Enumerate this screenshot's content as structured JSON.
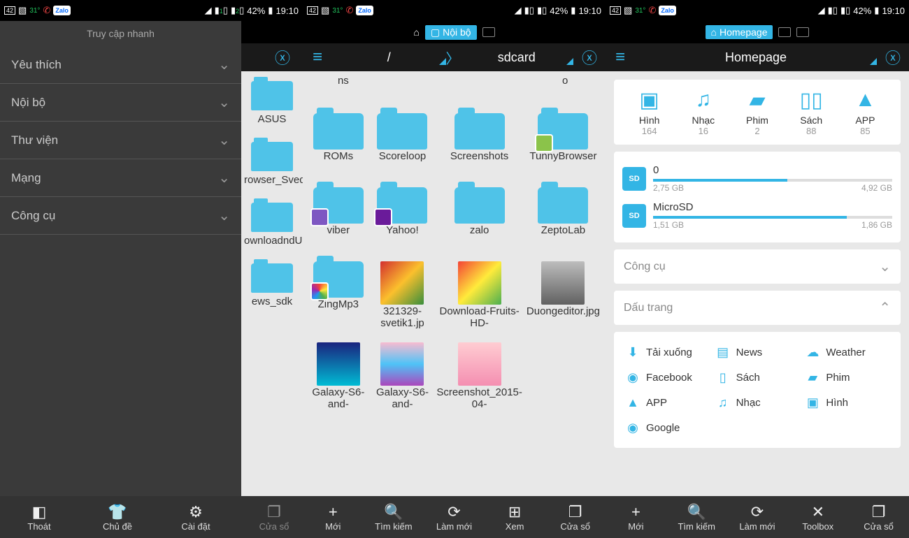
{
  "status": {
    "temp": "31°",
    "battery": "42%",
    "time": "19:10",
    "notif": "42"
  },
  "panel1": {
    "sidebar_title": "Truy cập nhanh",
    "items": [
      "Yêu thích",
      "Nội bộ",
      "Thư viện",
      "Mạng",
      "Công cụ"
    ],
    "bg_folders": [
      "ASUS",
      "rowser_SvedfiIes",
      "ownloadndUploa",
      "ews_sdk"
    ],
    "bottom": [
      "Thoát",
      "Chủ đề",
      "Cài đặt",
      "Cửa sổ"
    ]
  },
  "panel2": {
    "tab": "Nội bộ",
    "path": {
      "root": "/",
      "current": "sdcard"
    },
    "top_labels": [
      "ns",
      "o"
    ],
    "folders": [
      {
        "name": "ROMs",
        "type": "folder"
      },
      {
        "name": "Scoreloop",
        "type": "folder"
      },
      {
        "name": "Screenshots",
        "type": "folder"
      },
      {
        "name": "TunnyBrowser",
        "type": "folder",
        "badge": "#8bc34a"
      },
      {
        "name": "viber",
        "type": "folder",
        "badge": "#7e57c2"
      },
      {
        "name": "Yahoo!",
        "type": "folder",
        "badge": "#6a1b9a"
      },
      {
        "name": "zalo",
        "type": "folder"
      },
      {
        "name": "ZeptoLab",
        "type": "folder"
      },
      {
        "name": "ZingMp3",
        "type": "folder",
        "badge": "grad"
      },
      {
        "name": "321329-svetik1.jp",
        "type": "img",
        "bg": "linear-gradient(135deg,#d32f2f,#fbc02d,#388e3c)"
      },
      {
        "name": "Download-Fruits-HD-",
        "type": "img",
        "bg": "linear-gradient(135deg,#f44336,#ffeb3b,#4caf50)"
      },
      {
        "name": "Duongeditor.jpg",
        "type": "img",
        "bg": "linear-gradient(#bdbdbd,#616161)"
      },
      {
        "name": "Galaxy-S6-and-",
        "type": "img",
        "bg": "linear-gradient(180deg,#1a237e,#00bcd4)"
      },
      {
        "name": "Galaxy-S6-and-",
        "type": "img",
        "bg": "linear-gradient(180deg,#f8bbd0,#4fc3f7,#ab47bc)"
      },
      {
        "name": "Screenshot_2015-04-",
        "type": "img",
        "bg": "linear-gradient(#ffcdd2,#f48fb1)"
      }
    ],
    "bottom": [
      "Mới",
      "Tìm kiếm",
      "Làm mới",
      "Xem",
      "Cửa sổ"
    ]
  },
  "panel3": {
    "tab": "Homepage",
    "title": "Homepage",
    "categories": [
      {
        "name": "Hình",
        "count": "164",
        "icon": "▣"
      },
      {
        "name": "Nhạc",
        "count": "16",
        "icon": "♫"
      },
      {
        "name": "Phim",
        "count": "2",
        "icon": "▰"
      },
      {
        "name": "Sách",
        "count": "88",
        "icon": "▯▯"
      },
      {
        "name": "APP",
        "count": "85",
        "icon": "▲"
      }
    ],
    "storage": [
      {
        "name": "0",
        "used": "2,75 GB",
        "total": "4,92 GB",
        "pct": 56
      },
      {
        "name": "MicroSD",
        "used": "1,51 GB",
        "total": "1,86 GB",
        "pct": 81
      }
    ],
    "sections": {
      "tools": "Công cụ",
      "bookmarks": "Dấu trang"
    },
    "bookmarks": [
      {
        "name": "Tải xuống",
        "icon": "⬇"
      },
      {
        "name": "News",
        "icon": "▤"
      },
      {
        "name": "Weather",
        "icon": "☁"
      },
      {
        "name": "Facebook",
        "icon": "◉"
      },
      {
        "name": "Sách",
        "icon": "▯"
      },
      {
        "name": "Phim",
        "icon": "▰"
      },
      {
        "name": "APP",
        "icon": "▲"
      },
      {
        "name": "Nhạc",
        "icon": "♫"
      },
      {
        "name": "Hình",
        "icon": "▣"
      },
      {
        "name": "Google",
        "icon": "◉"
      }
    ],
    "bottom": [
      "Mới",
      "Tìm kiếm",
      "Làm mới",
      "Toolbox",
      "Cửa sổ"
    ]
  }
}
